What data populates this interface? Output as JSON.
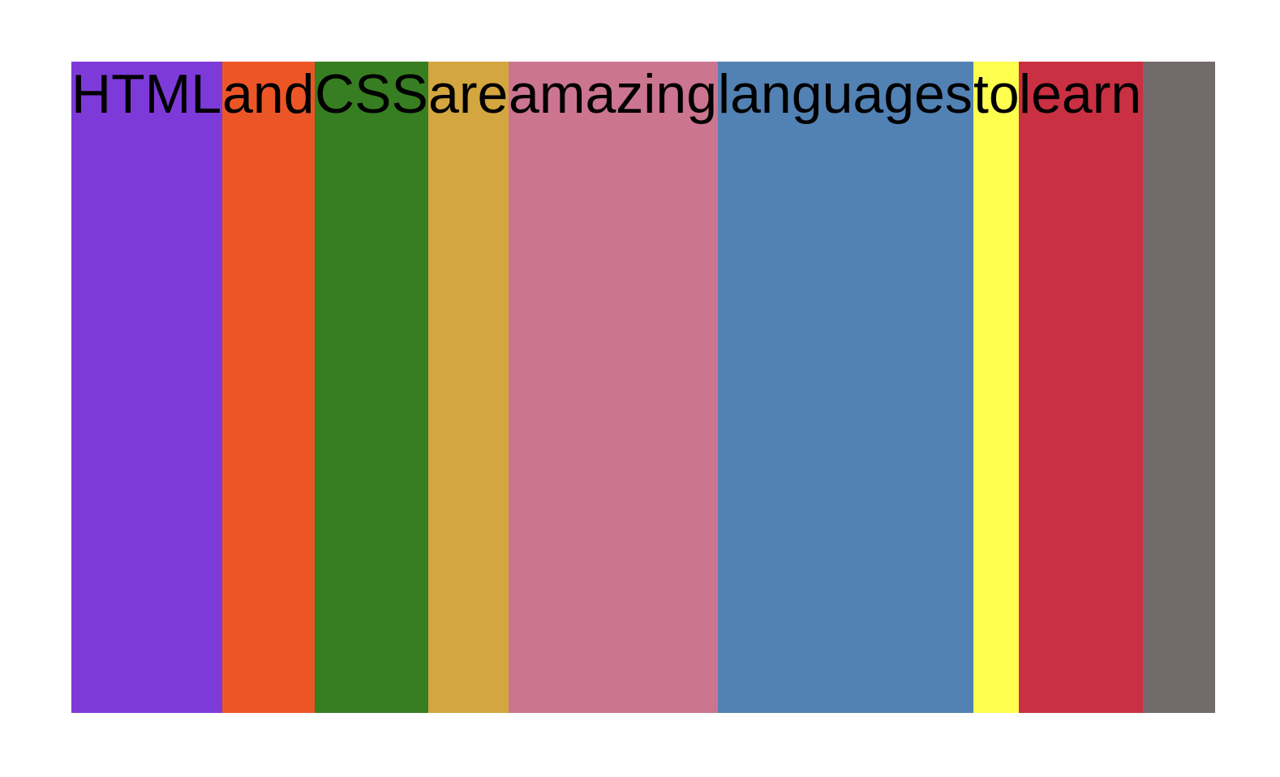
{
  "container": {
    "background": "#736b6b",
    "items": [
      {
        "word": "HTML",
        "color": "#7d3ad9"
      },
      {
        "word": "and",
        "color": "#ec5627"
      },
      {
        "word": "CSS",
        "color": "#377d22"
      },
      {
        "word": "are",
        "color": "#d3a63f"
      },
      {
        "word": "amazing",
        "color": "#cb7590"
      },
      {
        "word": "languages",
        "color": "#5281b3"
      },
      {
        "word": "to",
        "color": "#fefe4f"
      },
      {
        "word": "learn",
        "color": "#c93042"
      }
    ]
  }
}
